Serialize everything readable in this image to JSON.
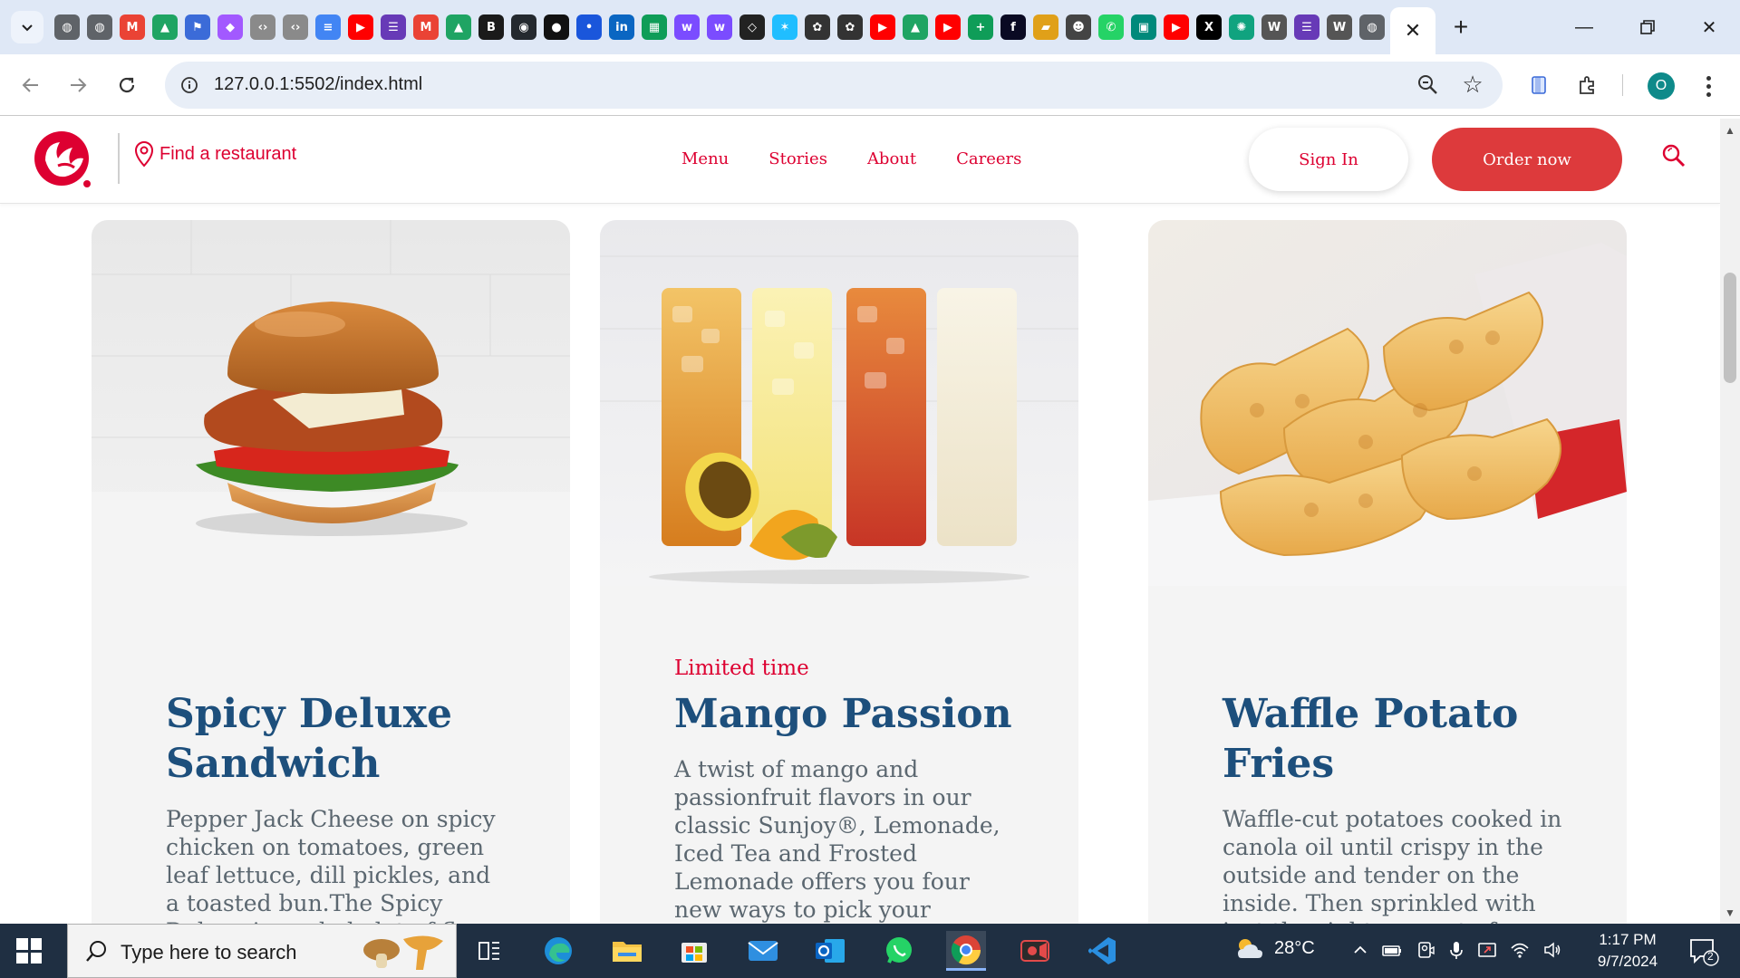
{
  "browser": {
    "url": "127.0.0.1:5502/index.html",
    "profile_initial": "O",
    "favicons": [
      "globe",
      "globe",
      "gmail",
      "drive",
      "flag",
      "figma",
      "code",
      "code",
      "docs",
      "youtube",
      "forms",
      "gmail",
      "drive",
      "bold",
      "github",
      "circle",
      "dot",
      "linkedin",
      "sheets",
      "wordtune",
      "wordtune",
      "codepen",
      "kaggle",
      "chatgpt",
      "chatgpt",
      "youtube",
      "drive",
      "youtube",
      "plus",
      "fcc",
      "hat",
      "robot",
      "whatsapp",
      "meet",
      "youtube",
      "x",
      "ai",
      "wiki",
      "forms",
      "wiki",
      "globe"
    ]
  },
  "site": {
    "find_restaurant": "Find a restaurant",
    "nav": [
      "Menu",
      "Stories",
      "About",
      "Careers"
    ],
    "sign_in": "Sign In",
    "order_now": "Order now",
    "brand_color": "#dd0031"
  },
  "cards": [
    {
      "tag": "",
      "title": "Spicy Deluxe Sandwich",
      "description": "Pepper Jack Cheese on spicy chicken on tomatoes, green leaf lettuce, dill pickles, and a toasted bun.The Spicy Deluxe is a whole lot of flavor to..."
    },
    {
      "tag": "Limited time",
      "title": "Mango Passion",
      "description": "A twist of mango and passionfruit flavors in our classic Sunjoy®, Lemonade, Iced Tea and Frosted Lemonade offers you four new ways to pick your paradise."
    },
    {
      "tag": "",
      "title": "Waffle Potato Fries",
      "description": "Waffle-cut potatoes cooked in canola oil until crispy in the outside and tender on the inside. Then sprinkled with just the right amount of sea salt."
    }
  ],
  "taskbar": {
    "search_placeholder": "Type here to search",
    "temperature": "28°C",
    "time": "1:17 PM",
    "date": "9/7/2024",
    "notification_count": "2"
  }
}
